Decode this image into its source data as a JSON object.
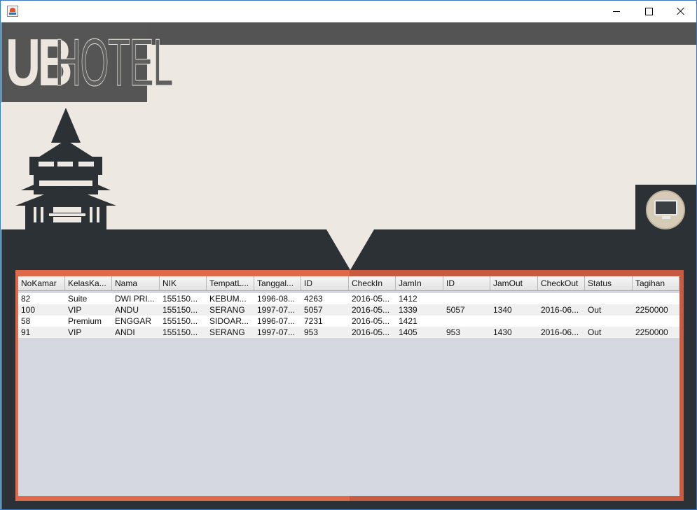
{
  "window": {
    "app_icon": "java-app-icon"
  },
  "brand": {
    "logo_part1": "UB",
    "logo_part2": "HOTEL"
  },
  "table": {
    "columns": [
      "NoKamar",
      "KelasKa...",
      "Nama",
      "NIK",
      "TempatL...",
      "Tanggal...",
      "ID",
      "CheckIn",
      "JamIn",
      "ID",
      "JamOut",
      "CheckOut",
      "Status",
      "Tagihan"
    ],
    "rows": [
      [
        "82",
        "Suite",
        "DWI PRI...",
        "155150...",
        "KEBUM...",
        "1996-08...",
        "4263",
        "2016-05...",
        "1412",
        "",
        "",
        "",
        "",
        ""
      ],
      [
        "100",
        "VIP",
        "ANDU",
        "155150...",
        "SERANG",
        "1997-07...",
        "5057",
        "2016-05...",
        "1339",
        "5057",
        "1340",
        "2016-06...",
        "Out",
        "2250000"
      ],
      [
        "58",
        "Premium",
        "ENGGAR",
        "155150...",
        "SIDOAR...",
        "1996-07...",
        "7231",
        "2016-05...",
        "1421",
        "",
        "",
        "",
        "",
        ""
      ],
      [
        "91",
        "VIP",
        "ANDI",
        "155150...",
        "SERANG",
        "1997-07...",
        "953",
        "2016-05...",
        "1405",
        "953",
        "1430",
        "2016-06...",
        "Out",
        "2250000"
      ]
    ]
  },
  "colors": {
    "accent_orange": "#e0694a",
    "dark": "#2b3134",
    "cream": "#ede8e1",
    "logo_bg": "#555555",
    "table_bg": "#d5d8e0"
  }
}
